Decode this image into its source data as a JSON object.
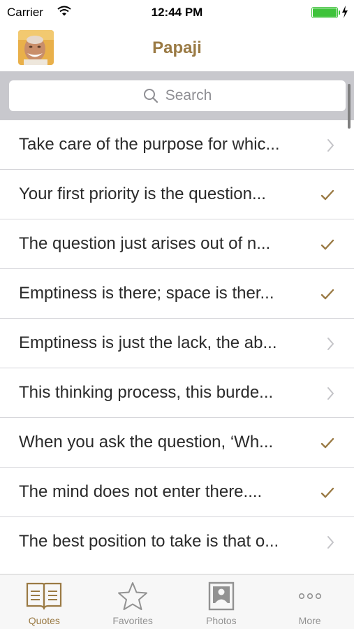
{
  "status_bar": {
    "carrier": "Carrier",
    "time": "12:44 PM"
  },
  "nav": {
    "title": "Papaji"
  },
  "search": {
    "placeholder": "Search"
  },
  "colors": {
    "accent": "#9a7a44",
    "battery": "#3ec33a",
    "separator": "#d6d6da"
  },
  "quotes": [
    {
      "text": "Take care of the purpose for whic...",
      "accessory": "chevron-right-icon"
    },
    {
      "text": "Your first priority is the question...",
      "accessory": "checkmark-icon"
    },
    {
      "text": "The question just arises out of n...",
      "accessory": "checkmark-icon"
    },
    {
      "text": "Emptiness is there; space is ther...",
      "accessory": "checkmark-icon"
    },
    {
      "text": "Emptiness is just the lack, the ab...",
      "accessory": "chevron-right-icon"
    },
    {
      "text": "This thinking process, this burde...",
      "accessory": "chevron-right-icon"
    },
    {
      "text": "When you ask the question, ‘Wh...",
      "accessory": "checkmark-icon"
    },
    {
      "text": "The mind does not enter there....",
      "accessory": "checkmark-icon"
    },
    {
      "text": "The best position to take is that o...",
      "accessory": "chevron-right-icon"
    }
  ],
  "tabs": [
    {
      "label": "Quotes",
      "icon": "book-icon",
      "active": true
    },
    {
      "label": "Favorites",
      "icon": "star-icon",
      "active": false
    },
    {
      "label": "Photos",
      "icon": "photo-icon",
      "active": false
    },
    {
      "label": "More",
      "icon": "more-icon",
      "active": false
    }
  ]
}
